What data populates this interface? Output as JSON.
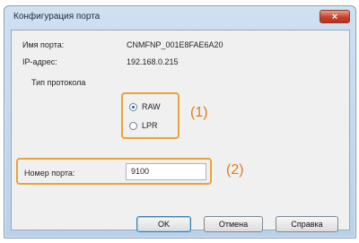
{
  "window": {
    "title": "Конфигурация порта",
    "close_label": "×"
  },
  "fields": {
    "port_name_label": "Имя порта:",
    "port_name_value": "CNMFNP_001E8FAE6A20",
    "ip_label": "IP-адрес:",
    "ip_value": "192.168.0.215",
    "protocol_label": "Тип протокола"
  },
  "protocol": {
    "options": [
      {
        "label": "RAW",
        "selected": true
      },
      {
        "label": "LPR",
        "selected": false
      }
    ]
  },
  "port_number": {
    "label": "Номер порта:",
    "value": "9100"
  },
  "callouts": {
    "one": "(1)",
    "two": "(2)"
  },
  "buttons": {
    "ok": "OK",
    "cancel": "Отмена",
    "help": "Справка"
  },
  "colors": {
    "highlight": "#e8a33a",
    "callout_text": "#e07b1a",
    "close_button": "#c5422c"
  }
}
